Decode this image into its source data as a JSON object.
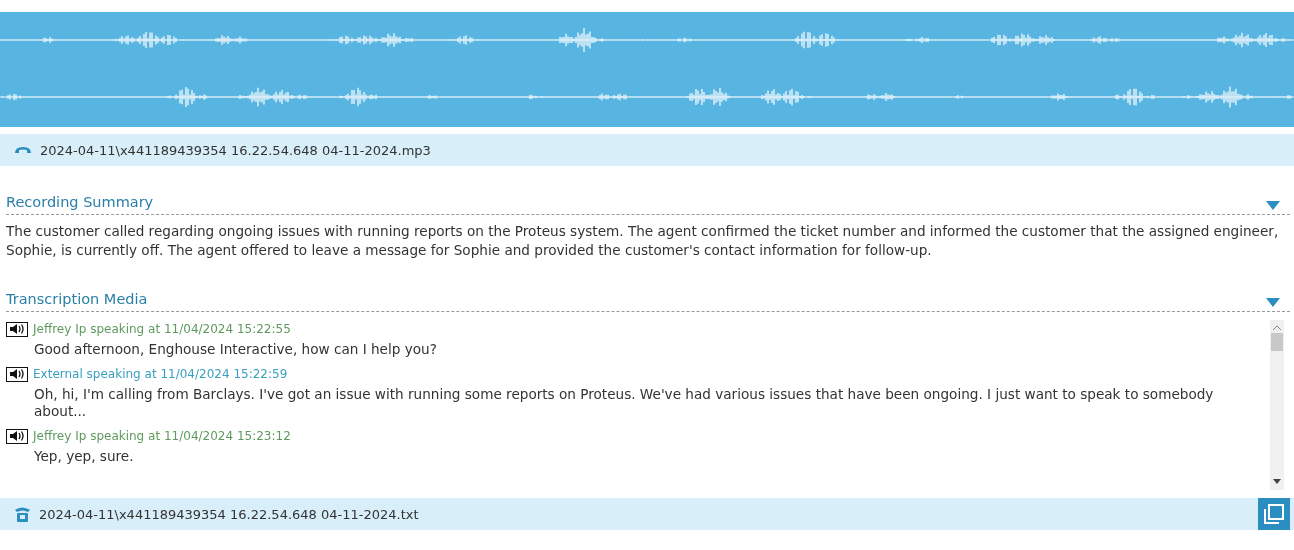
{
  "audio_file": {
    "name": "2024-04-11\\x441189439354 16.22.54.648 04-11-2024.mp3"
  },
  "summary": {
    "title": "Recording Summary",
    "expanded": true,
    "text": "The customer called regarding ongoing issues with running reports on the Proteus system. The agent confirmed the ticket number and informed the customer that the assigned engineer, Sophie, is currently off. The agent offered to leave a message for Sophie and provided the customer's contact information for follow-up."
  },
  "transcription": {
    "title": "Transcription Media",
    "expanded": true,
    "entries": [
      {
        "speaker": "Jeffrey Ip speaking at 11/04/2024 15:22:55",
        "color": "#5e9a5e",
        "text": "Good afternoon, Enghouse Interactive, how can I help you?"
      },
      {
        "speaker": "External speaking at 11/04/2024 15:22:59",
        "color": "#3aa0bf",
        "text": "Oh, hi, I'm calling from Barclays. I've got an issue with running some reports on Proteus. We've had various issues that have been ongoing. I just want to speak to somebody about..."
      },
      {
        "speaker": "Jeffrey Ip speaking at 11/04/2024 15:23:12",
        "color": "#5e9a5e",
        "text": "Yep, yep, sure."
      }
    ]
  },
  "text_file": {
    "name": "2024-04-11\\x441189439354 16.22.54.648 04-11-2024.txt"
  }
}
